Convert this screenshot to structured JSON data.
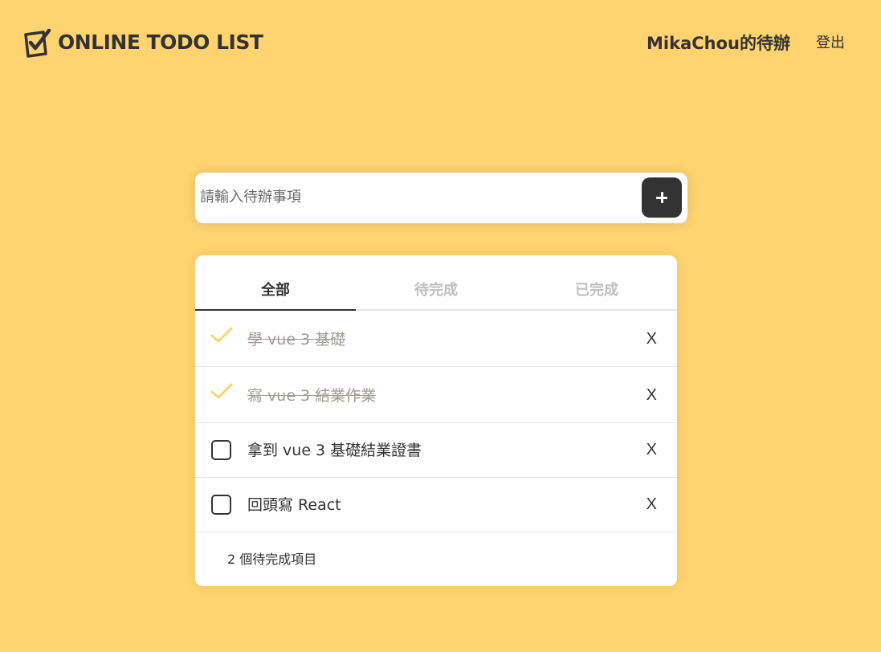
{
  "header": {
    "logo_text": "ONLINE TODO LIST",
    "user_title": "MikaChou的待辦",
    "logout_label": "登出"
  },
  "add_todo": {
    "placeholder": "請輸入待辦事項",
    "value": "",
    "button_icon": "plus-icon"
  },
  "tabs": [
    {
      "label": "全部",
      "active": true
    },
    {
      "label": "待完成",
      "active": false
    },
    {
      "label": "已完成",
      "active": false
    }
  ],
  "todos": [
    {
      "text": "學 vue 3 基礎",
      "done": true,
      "delete_label": "X"
    },
    {
      "text": "寫 vue 3 結業作業",
      "done": true,
      "delete_label": "X"
    },
    {
      "text": "拿到 vue 3 基礎結業證書",
      "done": false,
      "delete_label": "X"
    },
    {
      "text": "回頭寫 React",
      "done": false,
      "delete_label": "X"
    }
  ],
  "footer": {
    "pending_text": "2 個待完成項目"
  },
  "colors": {
    "background": "#FFD370",
    "accent_dark": "#333333",
    "check_color": "#FFD370",
    "done_text": "#9F9A91",
    "inactive_tab": "#BFBFBF"
  }
}
